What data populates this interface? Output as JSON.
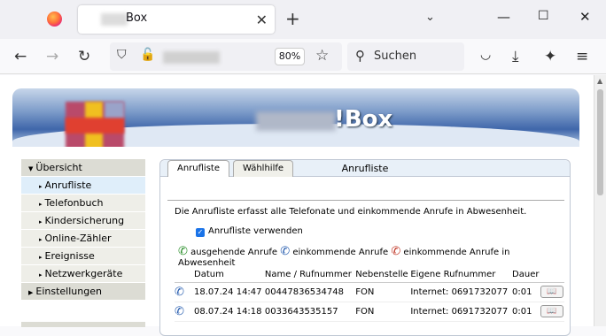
{
  "browser": {
    "tab_title": "Box",
    "new_tab": "+",
    "zoom": "80%",
    "search_placeholder": "Suchen"
  },
  "banner": {
    "product_name": "!Box"
  },
  "menu": {
    "items": [
      {
        "label": "Übersicht",
        "level": "top",
        "expanded": true
      },
      {
        "label": "Anrufliste",
        "level": "sub",
        "active": true
      },
      {
        "label": "Telefonbuch",
        "level": "sub"
      },
      {
        "label": "Kindersicherung",
        "level": "sub"
      },
      {
        "label": "Online-Zähler",
        "level": "sub"
      },
      {
        "label": "Ereignisse",
        "level": "sub"
      },
      {
        "label": "Netzwerkgeräte",
        "level": "sub"
      },
      {
        "label": "Einstellungen",
        "level": "top"
      }
    ]
  },
  "panel": {
    "title": "Anrufliste",
    "tabs": [
      "Anrufliste",
      "Wählhilfe"
    ],
    "description": "Die Anrufliste erfasst alle Telefonate und einkommende Anrufe in Abwesenheit.",
    "checkbox_label": "Anrufliste verwenden",
    "legend": {
      "outgoing": "ausgehende Anrufe",
      "incoming": "einkommende Anrufe",
      "missed": "einkommende Anrufe in Abwesenheit"
    },
    "columns": [
      "Datum",
      "Name / Rufnummer",
      "Nebenstelle",
      "Eigene Rufnummer",
      "Dauer"
    ],
    "rows": [
      {
        "date": "18.07.24 14:47",
        "number": "00447836534748",
        "ext": "FON",
        "own": "Internet: 0691732077",
        "duration": "0:01"
      },
      {
        "date": "08.07.24 14:18",
        "number": "0033643535157",
        "ext": "FON",
        "own": "Internet: 0691732077",
        "duration": "0:01"
      }
    ]
  }
}
